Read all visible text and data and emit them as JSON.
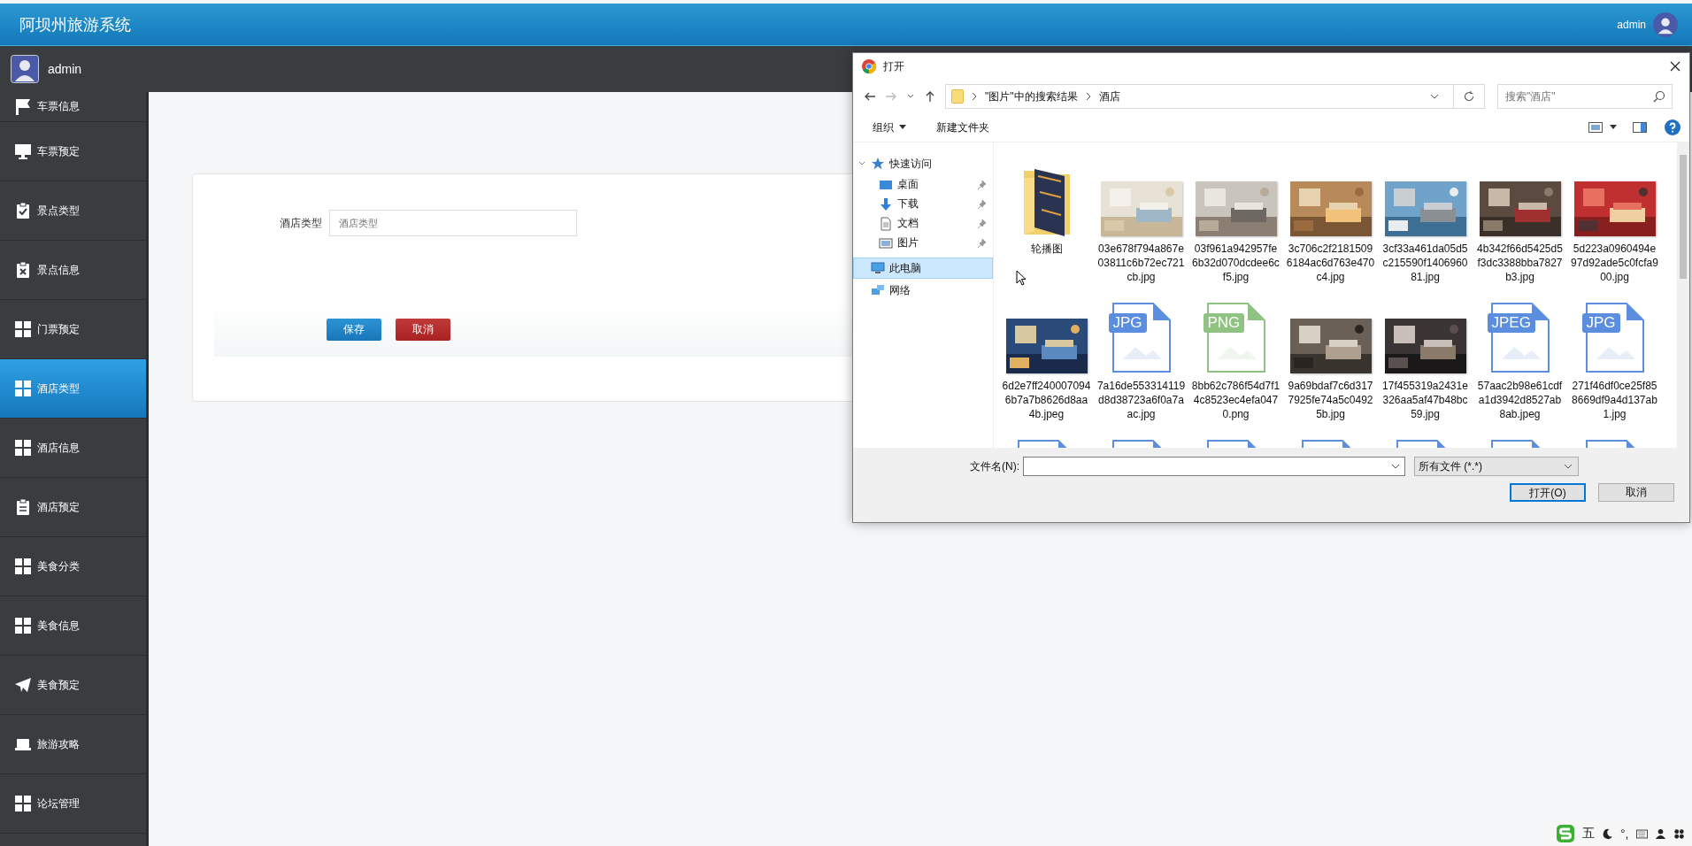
{
  "header": {
    "title": "阿坝州旅游系统",
    "user": "admin"
  },
  "user_bar": {
    "name": "admin"
  },
  "sidebar": {
    "items": [
      {
        "label": "车票信息",
        "kind": "flag",
        "selected": false
      },
      {
        "label": "车票预定",
        "kind": "monitor",
        "selected": false
      },
      {
        "label": "景点类型",
        "kind": "check",
        "selected": false
      },
      {
        "label": "景点信息",
        "kind": "cross",
        "selected": false
      },
      {
        "label": "门票预定",
        "kind": "grid",
        "selected": false
      },
      {
        "label": "酒店类型",
        "kind": "grid",
        "selected": true
      },
      {
        "label": "酒店信息",
        "kind": "grid",
        "selected": false
      },
      {
        "label": "酒店预定",
        "kind": "clipboard",
        "selected": false
      },
      {
        "label": "美食分类",
        "kind": "grid",
        "selected": false
      },
      {
        "label": "美食信息",
        "kind": "grid",
        "selected": false
      },
      {
        "label": "美食预定",
        "kind": "plane",
        "selected": false
      },
      {
        "label": "旅游攻略",
        "kind": "laptop",
        "selected": false
      },
      {
        "label": "论坛管理",
        "kind": "grid",
        "selected": false
      }
    ]
  },
  "form": {
    "fields": [
      {
        "label": "酒店类型",
        "placeholder": "酒店类型"
      }
    ],
    "buttons": [
      {
        "label": "保存",
        "kind": "primary"
      },
      {
        "label": "取消",
        "kind": "danger"
      }
    ]
  },
  "dialog": {
    "title": "打开",
    "path": [
      "\"图片\"中的搜索结果",
      "酒店"
    ],
    "search": {
      "placeholder": "搜索\"酒店\""
    },
    "toolbar": [
      {
        "label": "组织",
        "dropdown": true
      },
      {
        "label": "新建文件夹",
        "dropdown": false
      }
    ],
    "nav": [
      {
        "label": "快速访问",
        "kind": "star",
        "expanded": true,
        "selected": false,
        "children": [
          {
            "label": "桌面",
            "kind": "desktop",
            "pinned": true,
            "selected": false
          },
          {
            "label": "下载",
            "kind": "download",
            "pinned": true,
            "selected": false
          },
          {
            "label": "文档",
            "kind": "document",
            "pinned": true,
            "selected": false
          },
          {
            "label": "图片",
            "kind": "pictures",
            "pinned": true,
            "selected": false
          }
        ]
      },
      {
        "label": "此电脑",
        "kind": "computer",
        "selected": true
      },
      {
        "label": "网络",
        "kind": "network",
        "selected": false
      }
    ],
    "files": [
      {
        "kind": "folder",
        "name": "轮播图"
      },
      {
        "name": "03e678f794a867e03811c6b72ec721cb.jpg"
      },
      {
        "name": "03f961a942957fe6b32d070dcdee6cf5.jpg"
      },
      {
        "name": "3c706c2f21815096184ac6d763e470c4.jpg"
      },
      {
        "name": "3cf33a461da05d5c215590f140696081.jpg"
      },
      {
        "name": "4b342f66d5425d5f3dc3388bba7827b3.jpg"
      },
      {
        "name": "5d223a0960494e97d92ade5c0fcfa900.jpg"
      },
      {
        "name": "6d2e7ff2400070946b7a7b8626d8aa4b.jpeg"
      },
      {
        "kind": "file",
        "badge": "JPG",
        "color": "#5b8ede",
        "name": "7a16de553314119d8d38723a6f0a7aac.jpg"
      },
      {
        "kind": "file",
        "badge": "PNG",
        "color": "#8fc283",
        "name": "8bb62c786f54d7f14c8523ec4efa0470.png"
      },
      {
        "name": "9a69bdaf7c6d3177925fe74a5c04925b.jpg"
      },
      {
        "name": "17f455319a2431e326aa5af47b48bc59.jpg"
      },
      {
        "kind": "file",
        "badge": "JPEG",
        "color": "#5b8ede",
        "name": "57aac2b98e61cdfa1d3942d8527ab8ab.jpeg"
      },
      {
        "kind": "file",
        "badge": "JPG",
        "color": "#5b8ede",
        "name": "271f46df0ce25f858669df9a4d137ab1.jpg"
      },
      {
        "kind": "file",
        "color": "#5b8ede"
      },
      {
        "kind": "file",
        "color": "#5b8ede"
      },
      {
        "kind": "file",
        "color": "#5b8ede"
      },
      {
        "kind": "file",
        "color": "#5b8ede"
      },
      {
        "kind": "file",
        "color": "#5b8ede"
      },
      {
        "kind": "file",
        "color": "#5b8ede"
      },
      {
        "kind": "file",
        "color": "#5b8ede"
      }
    ],
    "filename": {
      "label": "文件名(N):"
    },
    "filter": "所有文件 (*.*)",
    "buttons": [
      {
        "label": "打开(O)",
        "selected": true
      },
      {
        "label": "取消",
        "selected": false
      }
    ]
  },
  "ime": {
    "items": [
      {
        "kind": "text",
        "label": "五"
      },
      {
        "kind": "moon"
      },
      {
        "kind": "text",
        "label": "°,"
      },
      {
        "kind": "keyboard"
      },
      {
        "kind": "person"
      },
      {
        "kind": "grid"
      }
    ]
  }
}
